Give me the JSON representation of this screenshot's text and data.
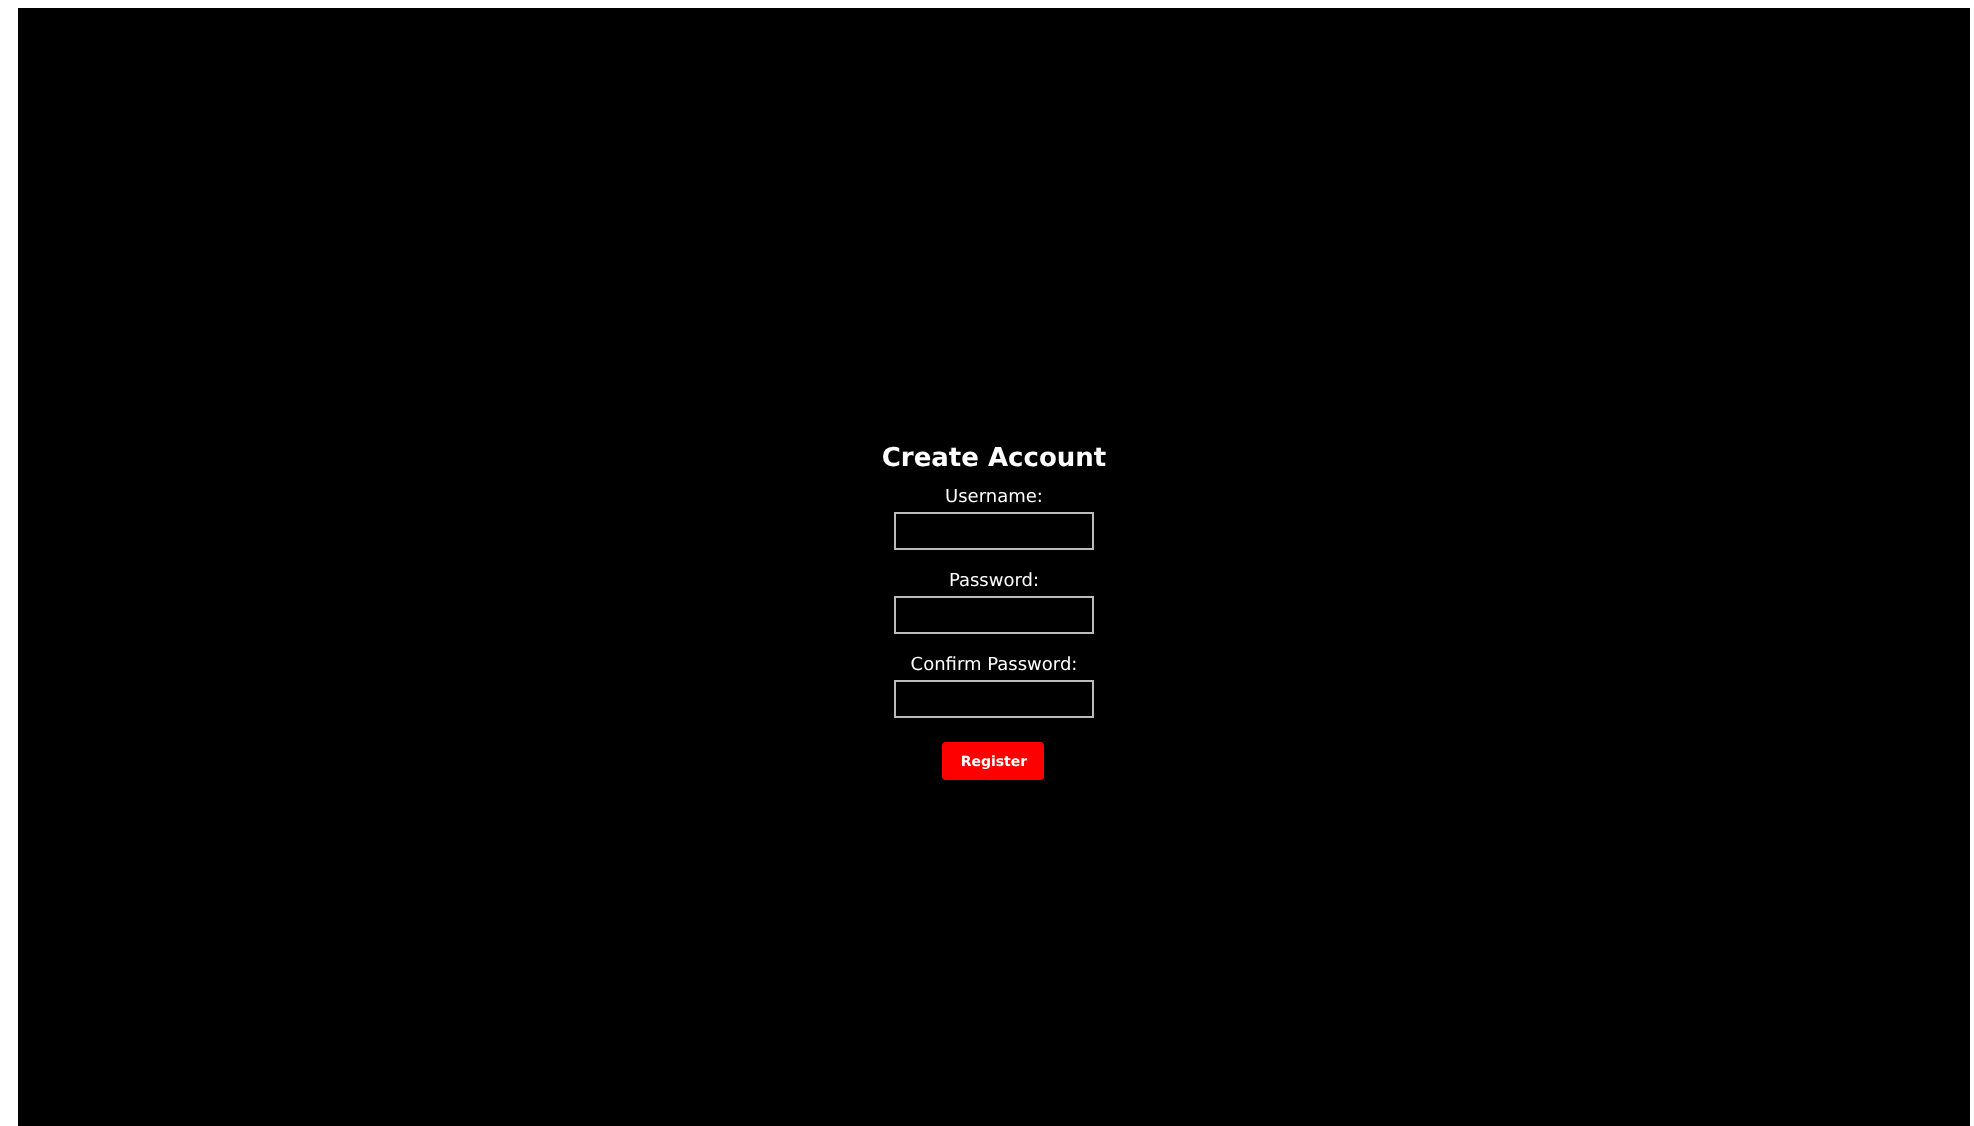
{
  "form": {
    "title": "Create Account",
    "fields": [
      {
        "label": "Username:"
      },
      {
        "label": "Password:"
      },
      {
        "label": "Confirm Password:"
      }
    ],
    "button": "Register"
  }
}
